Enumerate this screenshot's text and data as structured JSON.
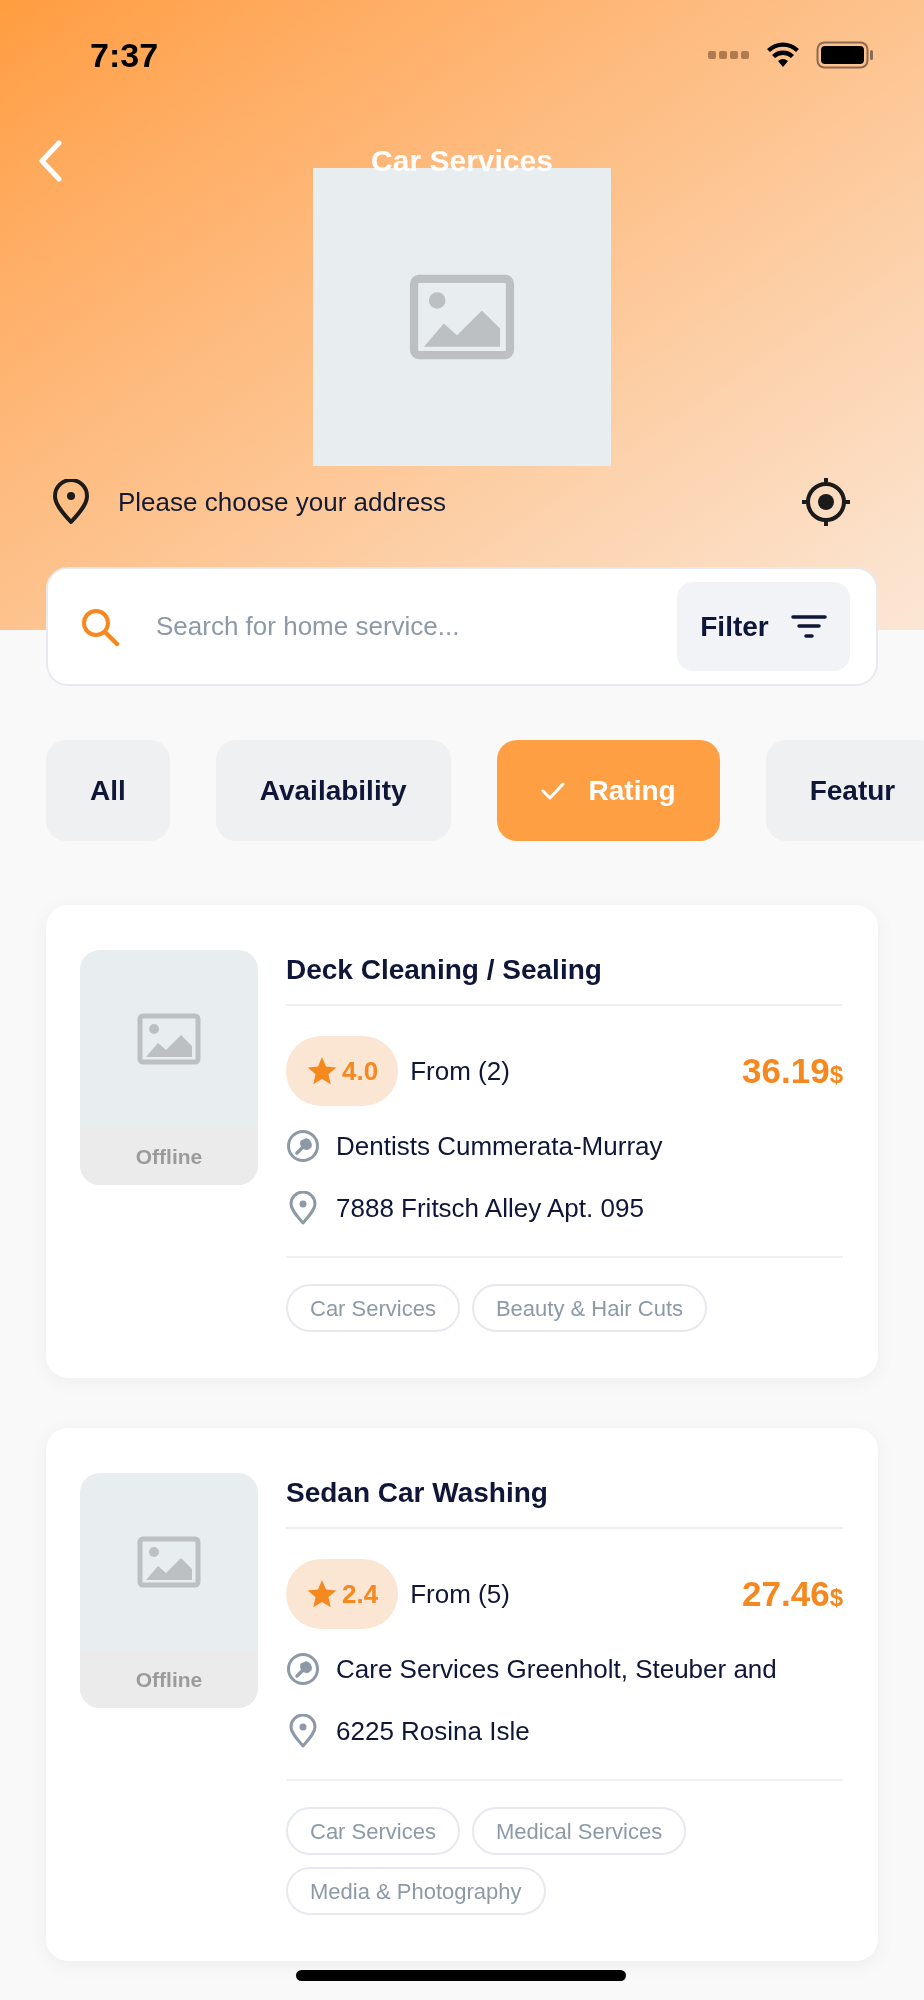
{
  "status_bar": {
    "time": "7:37"
  },
  "header": {
    "title": "Car Services"
  },
  "address": {
    "label": "Please choose your address"
  },
  "search": {
    "placeholder": "Search for home service...",
    "filter_button": "Filter"
  },
  "chips": [
    {
      "label": "All",
      "selected": false
    },
    {
      "label": "Availability",
      "selected": false
    },
    {
      "label": "Rating",
      "selected": true
    },
    {
      "label": "Featur",
      "selected": false
    }
  ],
  "services": [
    {
      "title": "Deck Cleaning / Sealing",
      "status": "Offline",
      "rating": "4.0",
      "from": "From (2)",
      "price": "36.19",
      "currency": "$",
      "provider": "Dentists Cummerata-Murray",
      "address": "7888 Fritsch Alley Apt. 095",
      "tags": [
        "Car Services",
        "Beauty & Hair Cuts"
      ]
    },
    {
      "title": "Sedan Car Washing",
      "status": "Offline",
      "rating": "2.4",
      "from": "From (5)",
      "price": "27.46",
      "currency": "$",
      "provider": "Care Services Greenholt, Steuber and",
      "address": "6225 Rosina Isle",
      "tags": [
        "Car Services",
        "Medical Services",
        "Media & Photography"
      ]
    }
  ]
}
